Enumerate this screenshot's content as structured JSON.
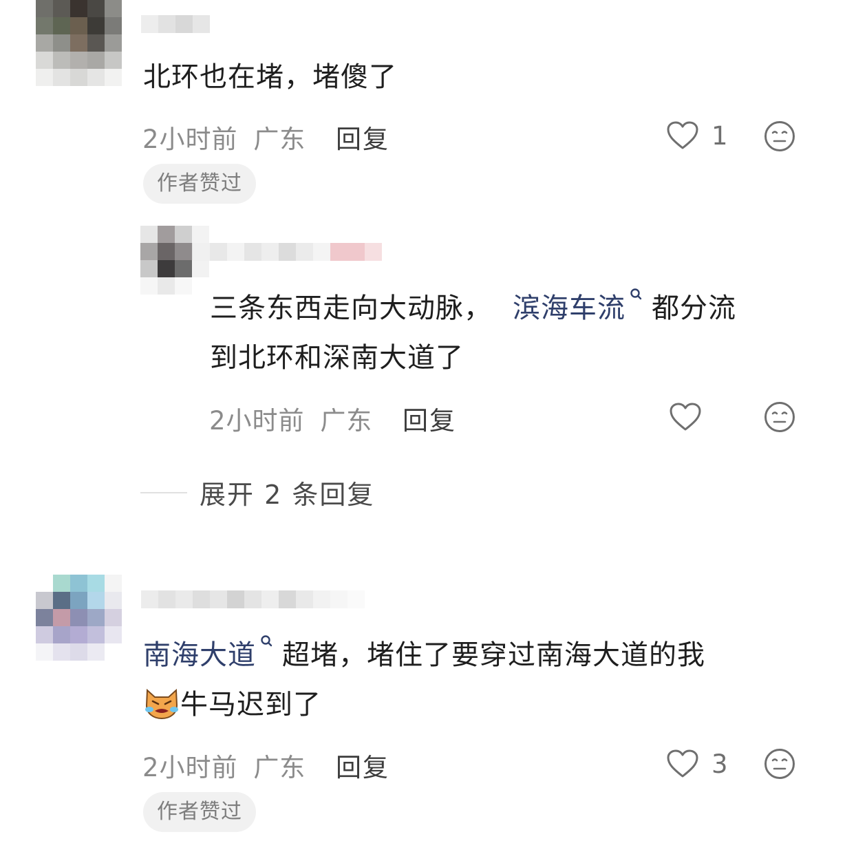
{
  "comments": [
    {
      "text": "北环也在堵，堵傻了",
      "time": "2小时前",
      "location": "广东",
      "reply_label": "回复",
      "like_count": "1",
      "badge": "作者赞过"
    },
    {
      "text_before": "三条东西走向大动脉，",
      "link": "滨海车流",
      "text_after": "都分流",
      "text_line2": "到北环和深南大道了",
      "time": "2小时前",
      "location": "广东",
      "reply_label": "回复"
    },
    {
      "link": "南海大道",
      "text_after": "超堵，堵住了要穿过南海大道的我",
      "text_line2": "牛马迟到了",
      "time": "2小时前",
      "location": "广东",
      "reply_label": "回复",
      "like_count": "3",
      "badge": "作者赞过"
    }
  ],
  "expand_replies": "展开 2 条回复",
  "icons": [
    "heart-icon",
    "meh-face-icon",
    "search-link-icon",
    "crying-cat-emoji"
  ],
  "colors": {
    "link": "#2f3f6b",
    "meta": "#8b8b8b",
    "badge_bg": "#f1f1f1"
  }
}
